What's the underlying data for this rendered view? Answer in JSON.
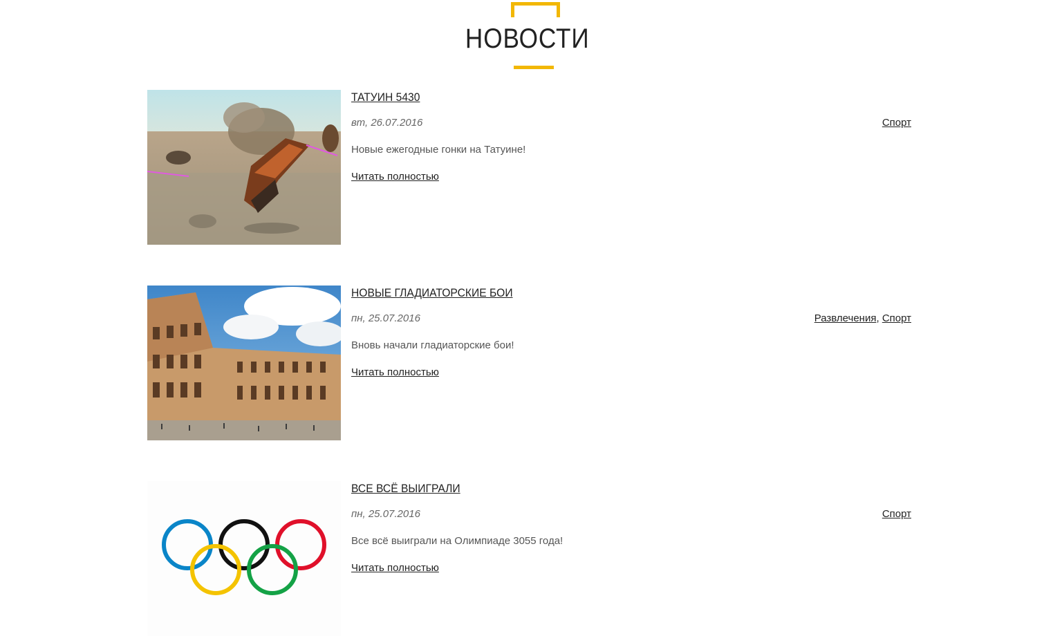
{
  "section": {
    "title": "НОВОСТИ",
    "accent_color": "#f2b705"
  },
  "news": [
    {
      "title": "ТАТУИН 5430",
      "date": "вт, 26.07.2016",
      "categories": [
        "Спорт"
      ],
      "description": "Новые ежегодные гонки на Татуине!",
      "read_more": "Читать полностью",
      "image": "podrace-image"
    },
    {
      "title": "НОВЫЕ ГЛАДИАТОРСКИЕ БОИ",
      "date": "пн, 25.07.2016",
      "categories": [
        "Развлечения",
        "Спорт"
      ],
      "description": "Вновь начали гладиаторские бои!",
      "read_more": "Читать полностью",
      "image": "colosseum-image"
    },
    {
      "title": "ВСЕ ВСЁ ВЫИГРАЛИ",
      "date": "пн, 25.07.2016",
      "categories": [
        "Спорт"
      ],
      "description": "Все всё выиграли на Олимпиаде 3055 года!",
      "read_more": "Читать полностью",
      "image": "olympic-rings-image"
    }
  ]
}
